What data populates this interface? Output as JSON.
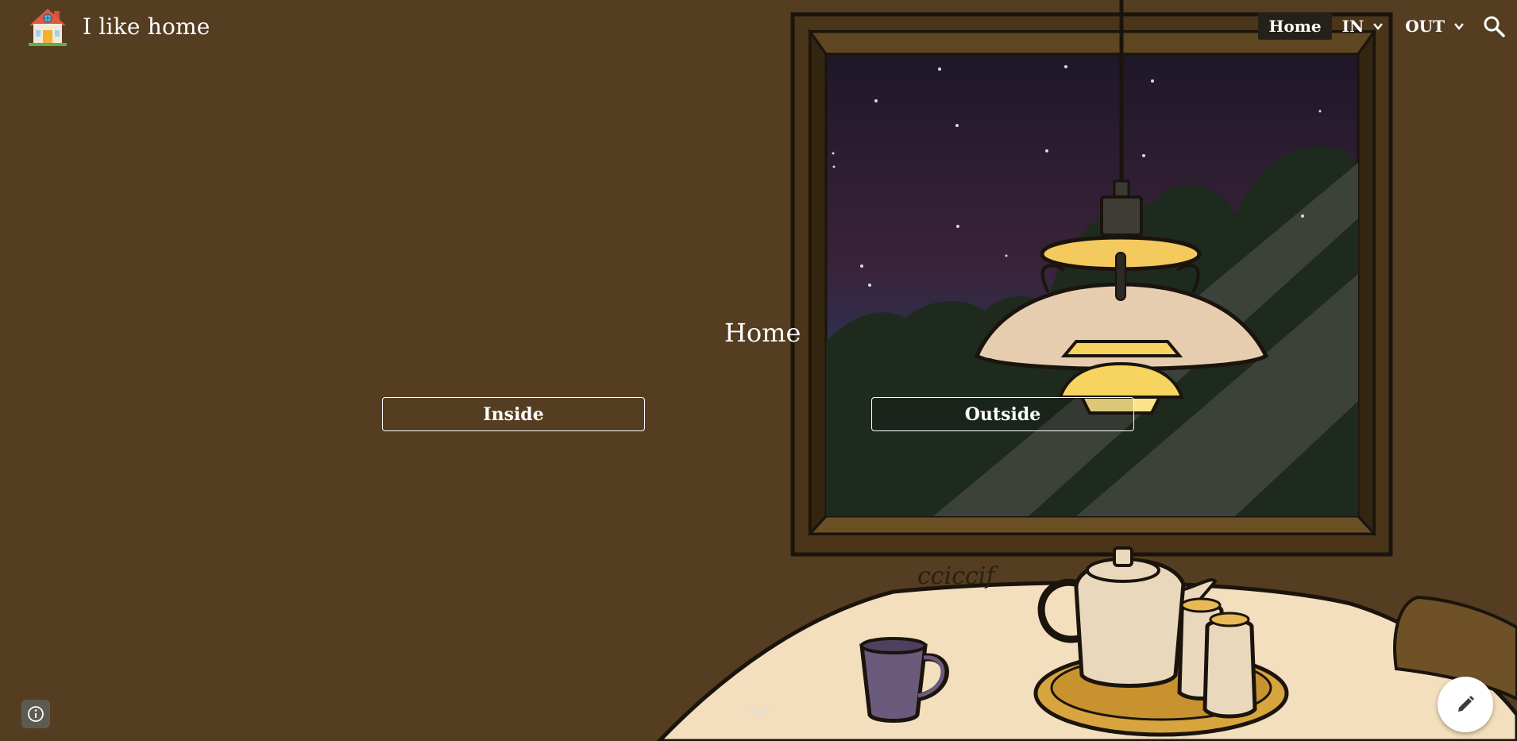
{
  "site": {
    "title": "I like home",
    "logo_icon": "house-icon"
  },
  "nav": {
    "items": [
      {
        "label": "Home",
        "active": true
      },
      {
        "label": "IN",
        "has_dropdown": true
      },
      {
        "label": "OUT",
        "has_dropdown": true
      }
    ],
    "search_icon": "search-icon"
  },
  "main": {
    "heading": "Home",
    "buttons": [
      {
        "label": "Inside"
      },
      {
        "label": "Outside"
      }
    ]
  },
  "illustration": {
    "signature": "cciccif",
    "description_icon": "lamp-window-table-illustration"
  },
  "controls": {
    "scroll_icon": "chevron-down-icon",
    "info_icon": "info-icon",
    "edit_icon": "pencil-icon"
  },
  "colors": {
    "background": "#553d21",
    "nav_active": "#252019",
    "lamp_yellow": "#f4c95d",
    "table": "#f3dfbd"
  }
}
